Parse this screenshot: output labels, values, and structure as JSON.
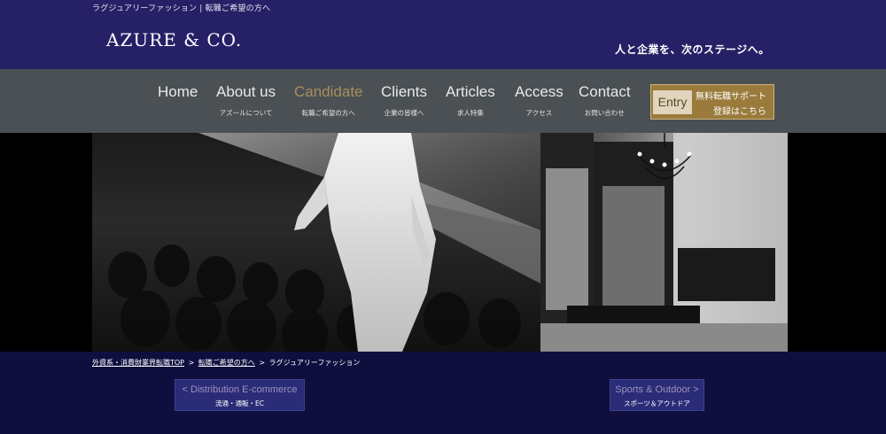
{
  "header": {
    "top_note": "ラグジュアリーファッション | 転職ご希望の方へ",
    "logo": "AZURE & CO.",
    "tagline": "人と企業を、次のステージへ。"
  },
  "nav": {
    "items": [
      {
        "en": "Home",
        "ja": ""
      },
      {
        "en": "About us",
        "ja": "アズールについて"
      },
      {
        "en": "Candidate",
        "ja": "転職ご希望の方へ"
      },
      {
        "en": "Clients",
        "ja": "企業の皆様へ"
      },
      {
        "en": "Articles",
        "ja": "求人特集"
      },
      {
        "en": "Access",
        "ja": "アクセス"
      },
      {
        "en": "Contact",
        "ja": "お問い合わせ"
      }
    ],
    "active_index": 2,
    "active_color": "#a98f5b"
  },
  "entry": {
    "label": "Entry",
    "line1": "無料転職サポート",
    "line2": "登録はこちら",
    "color": "#9a7b3c"
  },
  "breadcrumb": {
    "items": [
      "外資系・消費財業界転職TOP",
      "転職ご希望の方へ",
      "ラグジュアリーファッション"
    ],
    "separator": ">"
  },
  "pager": {
    "prev": {
      "title": "< Distribution E-commerce",
      "sub": "流通・通販・EC"
    },
    "next": {
      "title": "Sports & Outdoor >",
      "sub": "スポーツ＆アウトドア"
    }
  },
  "colors": {
    "header_bg": "#262166",
    "nav_bg": "#4a5053",
    "page_bg": "#0f0f3f"
  }
}
